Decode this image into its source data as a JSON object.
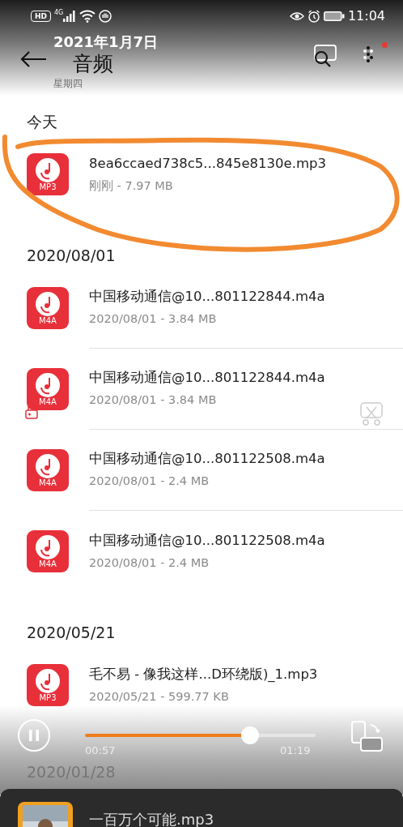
{
  "status_bar": {
    "hd": "HD",
    "network": "4G",
    "time": "11:04"
  },
  "toolbar": {
    "title": "音频",
    "overlay_date": "2021年1月7日",
    "overlay_weekday": "星期四",
    "menu_badge": true
  },
  "sections": [
    {
      "heading": "今天",
      "files": [
        {
          "name": "8ea6ccaed738c5...845e8130e.mp3",
          "meta": "刚刚 - 7.97 MB",
          "type": "MP3",
          "highlighted": true
        }
      ]
    },
    {
      "heading": "2020/08/01",
      "files": [
        {
          "name": "中国移动通信@10...801122844.m4a",
          "meta": "2020/08/01 - 3.84 MB",
          "type": "M4A",
          "highlighted": false
        },
        {
          "name": "中国移动通信@10...801122844.m4a",
          "meta": "2020/08/01 - 3.84 MB",
          "type": "M4A",
          "highlighted": false
        },
        {
          "name": "中国移动通信@10...801122508.m4a",
          "meta": "2020/08/01 - 2.4 MB",
          "type": "M4A",
          "highlighted": false
        },
        {
          "name": "中国移动通信@10...801122508.m4a",
          "meta": "2020/08/01 - 2.4 MB",
          "type": "M4A",
          "highlighted": false
        }
      ]
    },
    {
      "heading": "2020/05/21",
      "files": [
        {
          "name": "毛不易 - 像我这样...D环绕版)_1.mp3",
          "meta": "2020/05/21 - 599.77 KB",
          "type": "MP3",
          "highlighted": false
        }
      ]
    },
    {
      "heading": "2020/01/28"
    }
  ],
  "player": {
    "playing": true,
    "level": 0.716,
    "elapsed": "00:57",
    "total": "01:19"
  },
  "now_playing": {
    "title": "一百万个可能.mp3"
  }
}
